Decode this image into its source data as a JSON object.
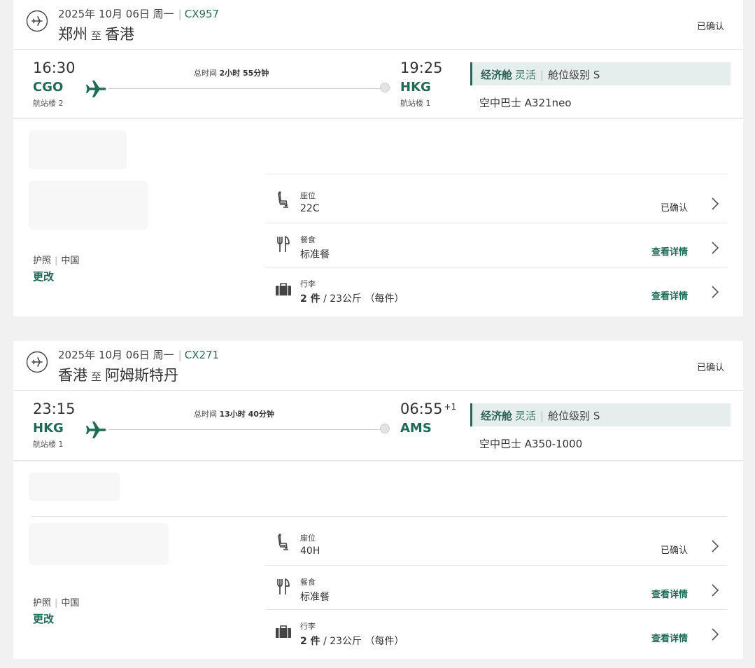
{
  "flights": [
    {
      "date": "2025年 10月 06日 周一",
      "flight_no": "CX957",
      "from_city": "郑州",
      "to_word": "至",
      "to_city": "香港",
      "status": "已确认",
      "dep_time": "16:30",
      "dep_code": "CGO",
      "dep_terminal": "航站楼 2",
      "duration_label": "总时间",
      "duration": "2小时 55分钟",
      "arr_time": "19:25",
      "arr_day_offset": "",
      "arr_code": "HKG",
      "arr_terminal": "航站楼 1",
      "cabin_class": "经济舱",
      "fare_type": "灵活",
      "booking_class": "舱位级别 S",
      "aircraft": "空中巴士 A321neo",
      "passport": "护照",
      "passport_country": "中国",
      "change_label": "更改",
      "services": [
        {
          "icon": "seat-icon",
          "label": "座位",
          "value": "22C",
          "value_bold": "",
          "action": "已确认",
          "action_link": false
        },
        {
          "icon": "meal-icon",
          "label": "餐食",
          "value": "标准餐",
          "value_bold": "",
          "action": "查看详情",
          "action_link": true
        },
        {
          "icon": "baggage-icon",
          "label": "行李",
          "value": " / 23公斤 （每件）",
          "value_bold": "2 件",
          "action": "查看详情",
          "action_link": true
        }
      ]
    },
    {
      "date": "2025年 10月 06日 周一",
      "flight_no": "CX271",
      "from_city": "香港",
      "to_word": "至",
      "to_city": "阿姆斯特丹",
      "status": "已确认",
      "dep_time": "23:15",
      "dep_code": "HKG",
      "dep_terminal": "航站楼 1",
      "duration_label": "总时间",
      "duration": "13小时 40分钟",
      "arr_time": "06:55",
      "arr_day_offset": "+1",
      "arr_code": "AMS",
      "arr_terminal": "",
      "cabin_class": "经济舱",
      "fare_type": "灵活",
      "booking_class": "舱位级别 S",
      "aircraft": "空中巴士 A350-1000",
      "passport": "护照",
      "passport_country": "中国",
      "change_label": "更改",
      "services": [
        {
          "icon": "seat-icon",
          "label": "座位",
          "value": "40H",
          "value_bold": "",
          "action": "已确认",
          "action_link": false
        },
        {
          "icon": "meal-icon",
          "label": "餐食",
          "value": "标准餐",
          "value_bold": "",
          "action": "查看详情",
          "action_link": true
        },
        {
          "icon": "baggage-icon",
          "label": "行李",
          "value": " / 23公斤 （每件）",
          "value_bold": "2 件",
          "action": "查看详情",
          "action_link": true
        }
      ]
    }
  ],
  "colors": {
    "brand_green": "#1f6b56",
    "cabin_bg": "#e5eeec",
    "page_bg": "#f0f1f0"
  }
}
